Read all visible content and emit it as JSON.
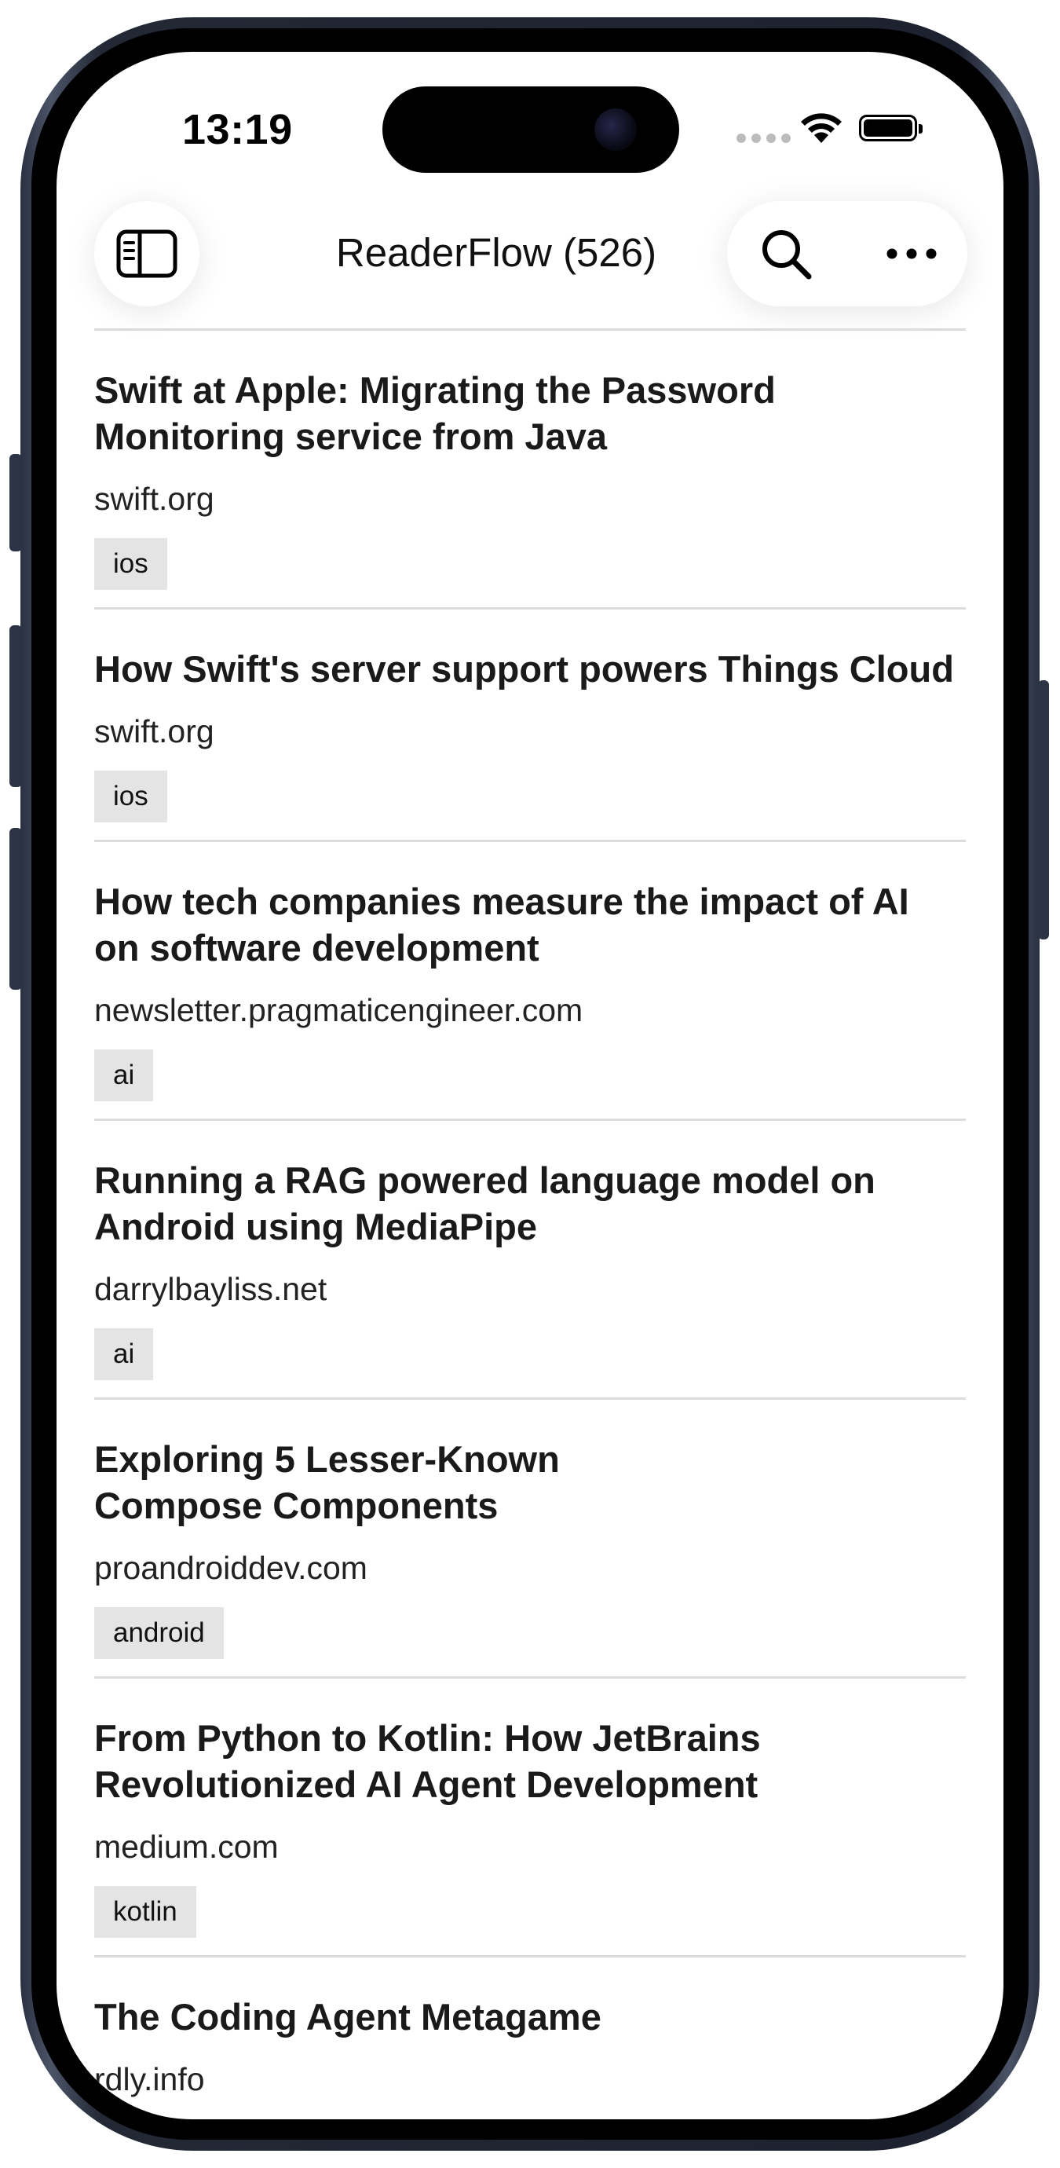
{
  "status_bar": {
    "time": "13:19",
    "wifi_icon": "wifi-icon",
    "battery_icon": "battery-icon"
  },
  "nav": {
    "title": "ReaderFlow (526)",
    "sidebar_icon": "sidebar-icon",
    "search_icon": "search-icon",
    "more_icon": "ellipsis-icon"
  },
  "items": [
    {
      "title": "Swift at Apple: Migrating the Password\nMonitoring service from Java",
      "domain": "swift.org",
      "tag": "ios"
    },
    {
      "title": "How Swift's server support powers Things Cloud",
      "domain": "swift.org",
      "tag": "ios"
    },
    {
      "title": "How tech companies measure the impact of AI\non software development",
      "domain": "newsletter.pragmaticengineer.com",
      "tag": "ai"
    },
    {
      "title": "Running a RAG powered language model on\nAndroid using MediaPipe",
      "domain": "darrylbayliss.net",
      "tag": "ai"
    },
    {
      "title": "Exploring 5 Lesser-Known\nCompose Components",
      "domain": "proandroiddev.com",
      "tag": "android"
    },
    {
      "title": "From Python to Kotlin: How JetBrains\nRevolutionized AI Agent Development",
      "domain": "medium.com",
      "tag": "kotlin"
    },
    {
      "title": "The Coding Agent Metagame",
      "domain": "rdly.info",
      "tag": ""
    }
  ],
  "colors": {
    "background": "#ffffff",
    "text": "#1a1a1a",
    "tag_bg": "#e4e4e4",
    "divider": "#dcdcdc"
  }
}
